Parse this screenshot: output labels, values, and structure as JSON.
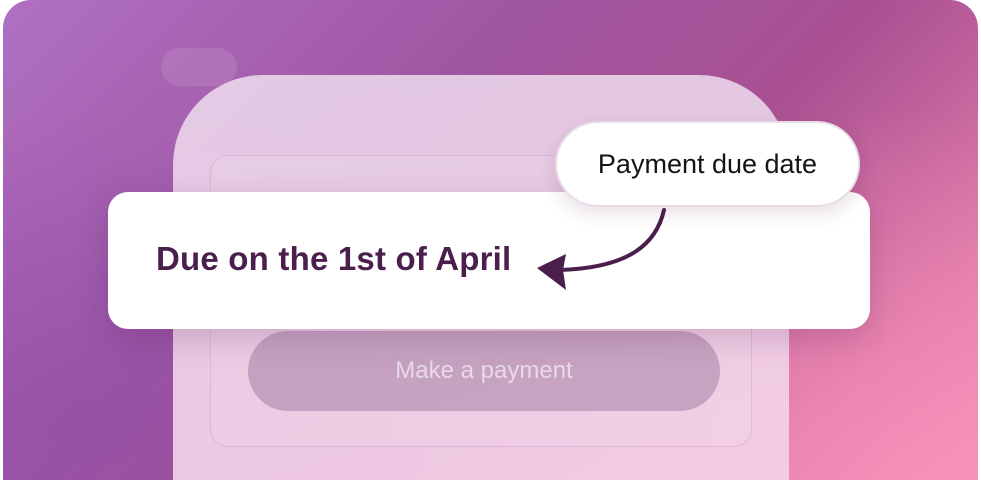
{
  "background_ghost": {
    "pill_label": "",
    "faint_label": ""
  },
  "due_card": {
    "text": "Due on the 1st of April"
  },
  "tooltip": {
    "label": "Payment due date"
  },
  "payment": {
    "button_label": "Make a payment"
  },
  "colors": {
    "accent_text": "#4a1f4c",
    "arrow": "#4a1f4c",
    "gradient_start": "#b070c2",
    "gradient_end": "#ef8fb7"
  },
  "icons": {
    "arrow": "curved-arrow-icon"
  }
}
